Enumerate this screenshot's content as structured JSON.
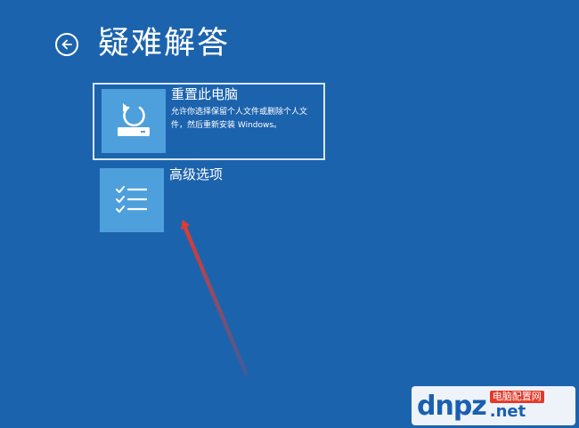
{
  "header": {
    "title": "疑难解答",
    "back_icon": "back-arrow-circle-icon"
  },
  "options": [
    {
      "title": "重置此电脑",
      "description": "允许你选择保留个人文件或删除个人文件，然后重新安装 Windows。",
      "icon": "reset-pc-icon",
      "selected": true
    },
    {
      "title": "高级选项",
      "description": "",
      "icon": "checklist-icon",
      "selected": false
    }
  ],
  "watermark": {
    "brand": "dnpz",
    "badge": "电脑配置网",
    "suffix": ".net"
  },
  "colors": {
    "background": "#1c63ae",
    "tile": "#4da0dc",
    "annotation_arrow": "#e8392b"
  }
}
